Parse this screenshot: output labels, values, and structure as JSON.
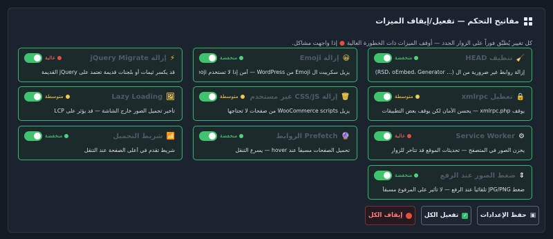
{
  "header": {
    "title": "مفاتيح التحكم — تفعيل/إيقاف الميزات"
  },
  "subtitle": {
    "text": "كل تغيير يُطبَّق فوراً على الزوار الجدد — أوقف الميزات ذات الخطورة العالية",
    "tail": "إذا واجهت مشاكل."
  },
  "badges": {
    "low": "منخفضة",
    "mid": "متوسطة",
    "high": "عالية"
  },
  "cards": [
    {
      "title": "تنظيف HEAD",
      "icon": "broom-icon",
      "glyph": "🧹",
      "desc": "إزالة روابط غير ضرورية من ال (... RSD، oEmbed، Generator) head",
      "level": "low"
    },
    {
      "title": "إزالة Emoji",
      "icon": "emoji-icon",
      "glyph": "😀",
      "desc": "يزيل سكريبت ال Emoji من WordPress — آمن إذا لا تستخدم Emoji",
      "level": "low"
    },
    {
      "title": "إزالة jQuery Migrate",
      "icon": "lightning-icon",
      "glyph": "⚡",
      "desc": "قد يكسر ثيمات أو بلجنات قديمة تعتمد على jQuery القديمة",
      "level": "high"
    },
    {
      "title": "تعطيل xmlrpc",
      "icon": "lock-icon",
      "glyph": "🔒",
      "desc": "يوقف xmlrpc.php — يحسن الأمان لكن يوقف بعض التطبيقات",
      "level": "mid"
    },
    {
      "title": "إزالة CSS/JS غير مستخدم",
      "icon": "trash-icon",
      "glyph": "🗑",
      "desc": "يزيل WooCommerce scripts من صفحات لا تحتاجها",
      "level": "mid"
    },
    {
      "title": "Lazy Loading",
      "icon": "image-icon",
      "glyph": "🖼",
      "desc": "تأخير تحميل الصور خارج الشاشة — قد يؤثر على LCP",
      "level": "mid"
    },
    {
      "title": "Service Worker",
      "icon": "gear-icon",
      "glyph": "⚙",
      "desc": "يخزن الصور في المتصفح — تحديثات الموقع قد تتأخر للزوار",
      "level": "high"
    },
    {
      "title": "Prefetch الروابط",
      "icon": "globe-icon",
      "glyph": "🔮",
      "desc": "تحميل الصفحات مسبقاً عند hover — يسرع التنقل",
      "level": "low"
    },
    {
      "title": "شريط التحميل",
      "icon": "chart-icon",
      "glyph": "📶",
      "desc": "شريط تقدم في أعلى الصفحة عند التنقل",
      "level": "low"
    },
    {
      "title": "ضغط الصور عند الرفع",
      "icon": "compress-icon",
      "glyph": "⇕",
      "desc": "ضغط JPG/PNG تلقائياً عند الرفع — لا تأثير على المرفوع مسبقاً",
      "level": "low"
    }
  ],
  "actions": {
    "save": "حفظ الإعدادات",
    "enable_all": "تفعيل الكل",
    "disable_all": "إيقاف الكل"
  }
}
